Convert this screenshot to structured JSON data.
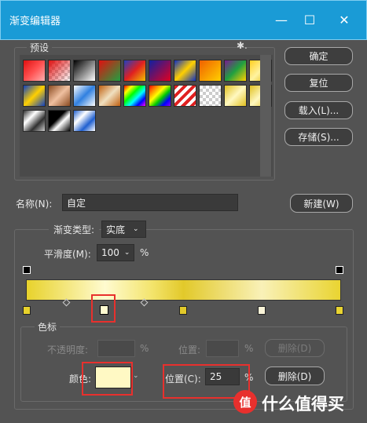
{
  "window": {
    "title": "渐变编辑器",
    "minimize_glyph": "—",
    "maximize_glyph": "☐",
    "close_glyph": "✕"
  },
  "presets": {
    "legend": "预设",
    "menu_glyph": "✱."
  },
  "buttons": {
    "ok": "确定",
    "reset": "复位",
    "load": "载入(L)...",
    "save": "存储(S)...",
    "new": "新建(W)"
  },
  "name": {
    "label": "名称(N):",
    "value": "自定"
  },
  "gradient_type": {
    "label": "渐变类型:",
    "value": "实底"
  },
  "smoothness": {
    "label": "平滑度(M):",
    "value": "100",
    "unit": "%"
  },
  "color_stops_group": {
    "legend": "色标",
    "opacity_label": "不透明度:",
    "opacity_unit": "%",
    "opacity_location_label": "位置:",
    "opacity_location_unit": "%",
    "opacity_delete": "删除(D)",
    "color_label": "颜色:",
    "color_value": "#FFF9C4",
    "color_location_label": "位置(C):",
    "color_location_value": "25",
    "color_location_unit": "%",
    "color_delete": "删除(D)"
  },
  "gradient": {
    "colors": [
      "#E8D22B",
      "#FFFBD0",
      "#F3E46C",
      "#E2C92A",
      "#F9F1B8",
      "#E9D431"
    ]
  },
  "watermark": {
    "text": "什么值得买",
    "logo_glyph": "值"
  }
}
